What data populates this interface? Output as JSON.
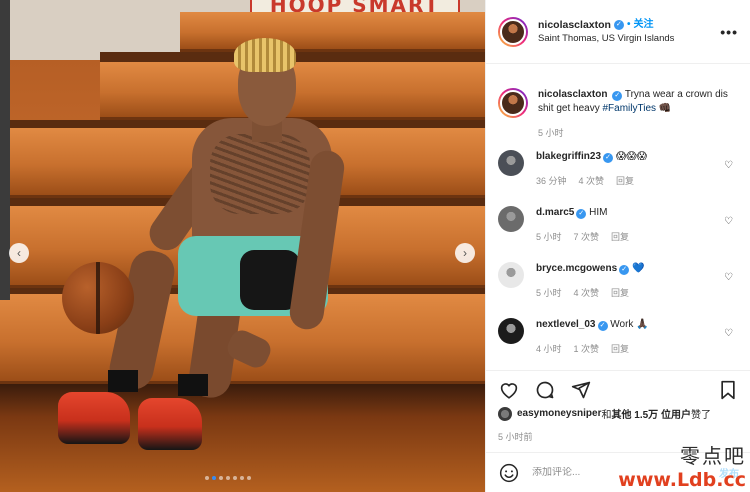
{
  "post": {
    "author": "nicolasclaxton",
    "follow_label": "关注",
    "follow_separator": "•",
    "location": "Saint Thomas, US Virgin Islands",
    "more_label": "•••"
  },
  "photo": {
    "banner_text": "HOOP SMART",
    "carousel_dots": 7,
    "active_dot": 1
  },
  "caption": {
    "username": "nicolasclaxton",
    "text": "Tryna wear a crown dis shit get heavy ",
    "hashtag": "#FamilyTies",
    "emoji": "👊🏿",
    "time": "5 小时"
  },
  "comments": [
    {
      "username": "blakegriffin23",
      "verified": true,
      "text": "😱😱😱",
      "time": "36 分钟",
      "likes": "4 次赞",
      "reply": "回复"
    },
    {
      "username": "d.marc5",
      "verified": true,
      "text": "HIM",
      "time": "5 小时",
      "likes": "7 次赞",
      "reply": "回复"
    },
    {
      "username": "bryce.mcgowens",
      "verified": true,
      "text": "💙",
      "time": "5 小时",
      "likes": "4 次赞",
      "reply": "回复"
    },
    {
      "username": "nextlevel_03",
      "verified": true,
      "text": "Work 🙏🏿",
      "time": "4 小时",
      "likes": "1 次赞",
      "reply": "回复"
    }
  ],
  "likes": {
    "liker": "easymoneysniper",
    "and": " 和 ",
    "others": "其他 1.5万 位用户",
    "suffix": " 赞了"
  },
  "posted_time": "5 小时前",
  "composer": {
    "placeholder": "添加评论...",
    "post_label": "发布"
  },
  "watermark": {
    "line1": "零点吧",
    "line2": "www.Ldb.cc"
  },
  "colors": {
    "link_blue": "#0095f6",
    "verified_blue": "#3897f0",
    "muted": "#8e8e8e",
    "text": "#262626"
  }
}
